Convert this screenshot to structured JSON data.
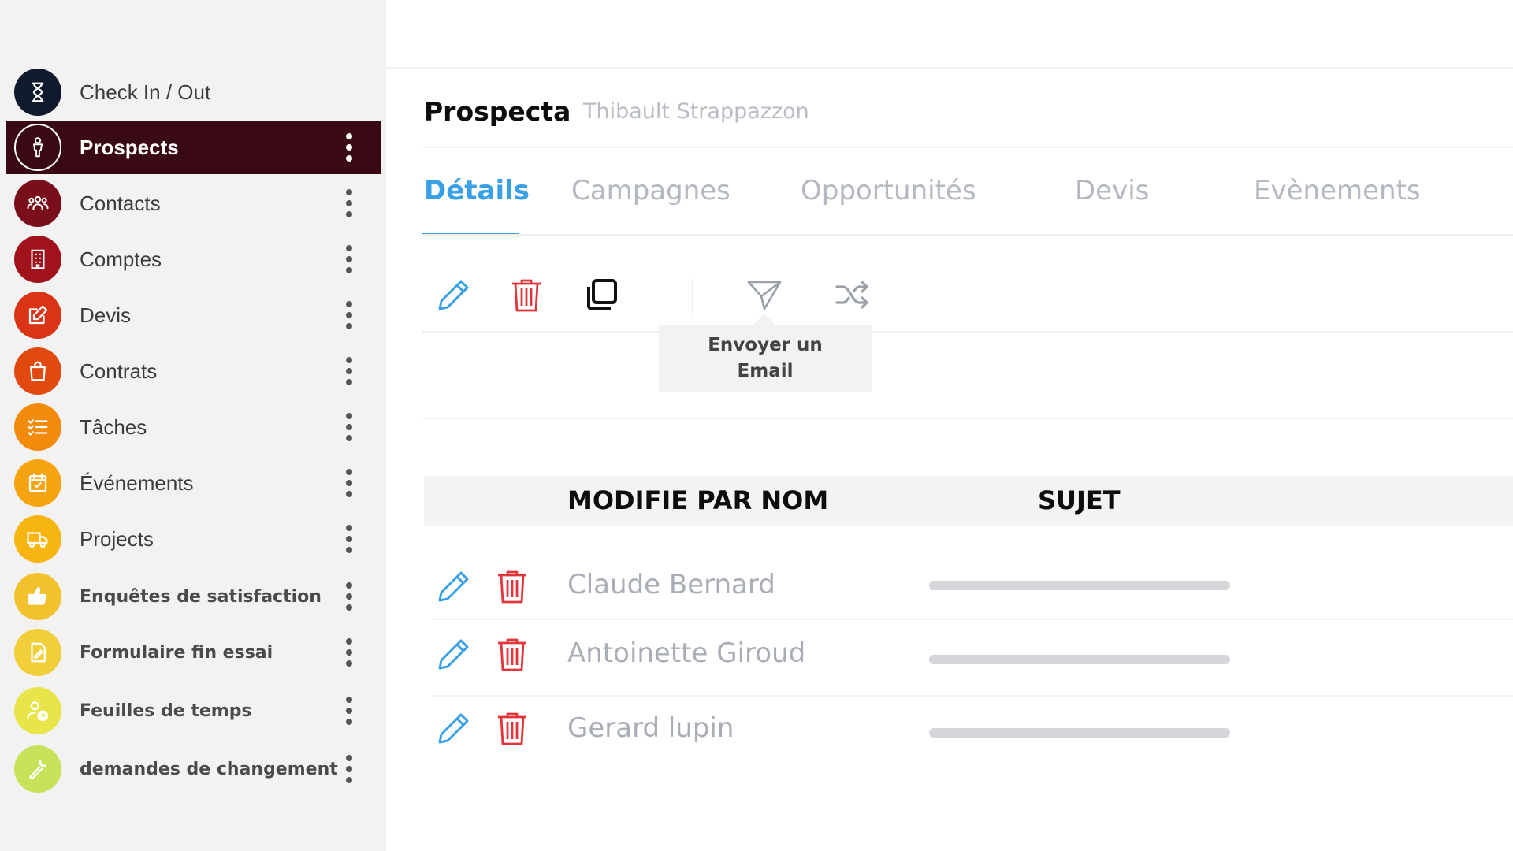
{
  "sidebar": {
    "items": [
      {
        "label": "Check In / Out",
        "icon": "hourglass-icon",
        "color": "#0f1a2e"
      },
      {
        "label": "Prospects",
        "icon": "person-icon",
        "color": "#3a0a14"
      },
      {
        "label": "Contacts",
        "icon": "group-icon",
        "color": "#7a0f1c"
      },
      {
        "label": "Comptes",
        "icon": "building-icon",
        "color": "#a0131c"
      },
      {
        "label": "Devis",
        "icon": "edit-icon",
        "color": "#d93415"
      },
      {
        "label": "Contrats",
        "icon": "bag-icon",
        "color": "#e04a10"
      },
      {
        "label": "Tâches",
        "icon": "checklist-icon",
        "color": "#f28a0c"
      },
      {
        "label": "Événements",
        "icon": "calendar-icon",
        "color": "#f5a30e"
      },
      {
        "label": "Projects",
        "icon": "truck-icon",
        "color": "#f7b512"
      },
      {
        "label": "Enquêtes de satisfaction",
        "icon": "thumbs-up-icon",
        "color": "#f2c12e"
      },
      {
        "label": "Formulaire fin essai",
        "icon": "document-icon",
        "color": "#f0cf3a"
      },
      {
        "label": "Feuilles de temps",
        "icon": "user-clock-icon",
        "color": "#e9e44a"
      },
      {
        "label": "demandes de changement",
        "icon": "wrench-icon",
        "color": "#c6e35a"
      }
    ]
  },
  "header": {
    "title": "Prospecta",
    "subtitle": "Thibault Strappazzon"
  },
  "tabs": [
    {
      "label": "Détails",
      "active": true
    },
    {
      "label": "Campagnes",
      "active": false
    },
    {
      "label": "Opportunités",
      "active": false
    },
    {
      "label": "Devis",
      "active": false
    },
    {
      "label": "Evènements",
      "active": false
    }
  ],
  "toolbar": {
    "tools": [
      "pencil-icon",
      "trash-icon",
      "copy-icon",
      "send-icon",
      "shuffle-icon"
    ],
    "tooltip": "Envoyer un Email"
  },
  "table": {
    "headers": [
      "MODIFIE PAR NOM",
      "SUJET"
    ],
    "rows": [
      {
        "name": "Claude Bernard"
      },
      {
        "name": "Antoinette Giroud"
      },
      {
        "name": "Gerard lupin"
      }
    ]
  },
  "colors": {
    "accent": "#3aa0e6",
    "danger": "#e0353a",
    "active_sidebar": "#3a0a14"
  }
}
